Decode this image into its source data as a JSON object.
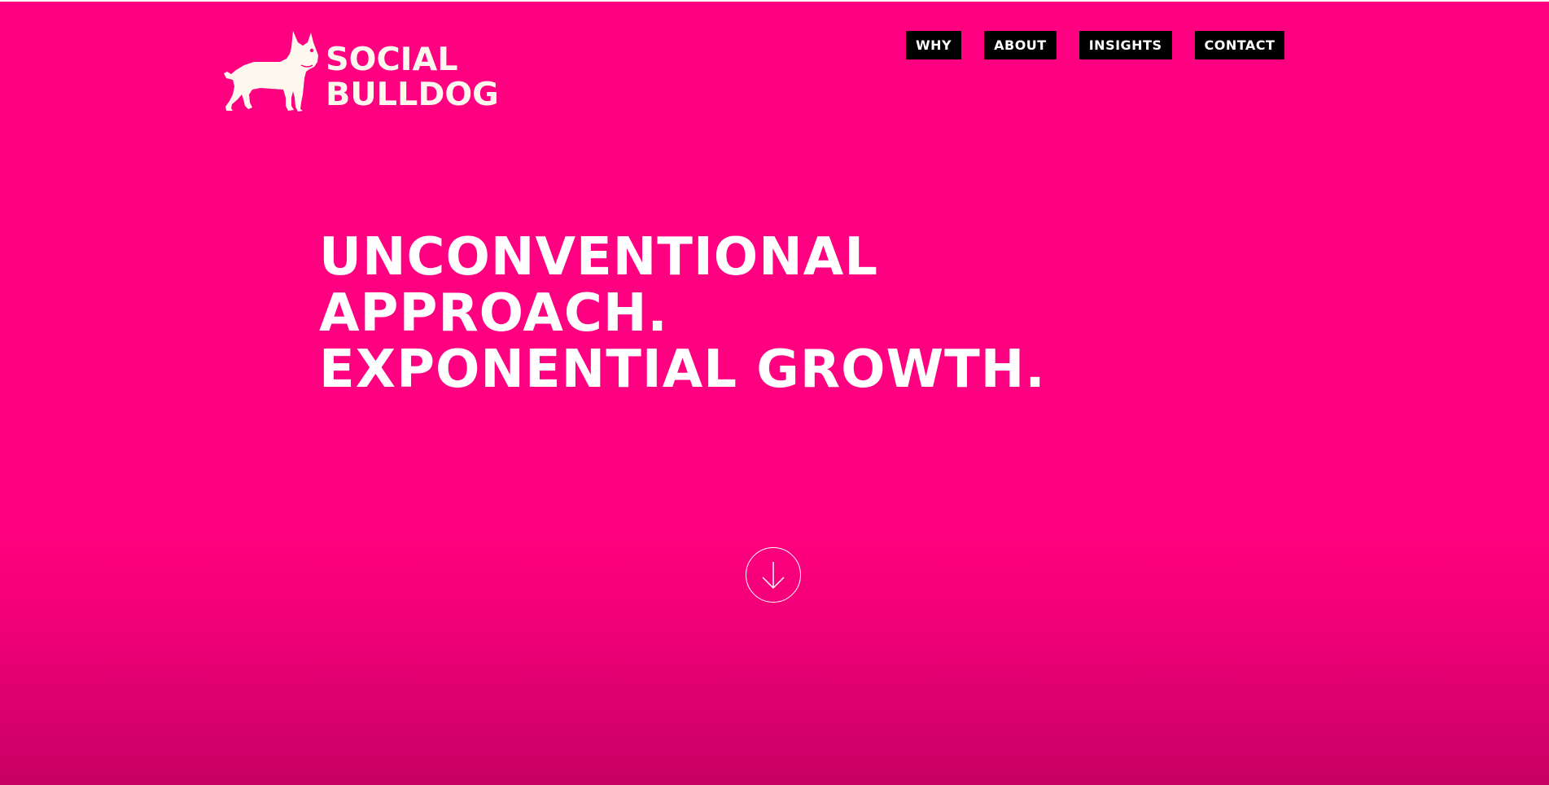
{
  "brand": {
    "line1": "SOCIAL",
    "line2": "BULLDOG",
    "logo_icon": "bulldog-silhouette-icon"
  },
  "nav": {
    "items": [
      {
        "label": "WHY"
      },
      {
        "label": "ABOUT"
      },
      {
        "label": "INSIGHTS"
      },
      {
        "label": "CONTACT"
      }
    ]
  },
  "hero": {
    "line1": "UNCONVENTIONAL",
    "line2": "APPROACH.",
    "line3": "EXPONENTIAL GROWTH."
  },
  "scroll": {
    "icon": "arrow-down-circle-icon"
  },
  "colors": {
    "background": "#ff0080",
    "background_bottom": "#c70063",
    "nav_background": "#000000",
    "text": "#ffffff",
    "logo": "#fff8ee"
  }
}
